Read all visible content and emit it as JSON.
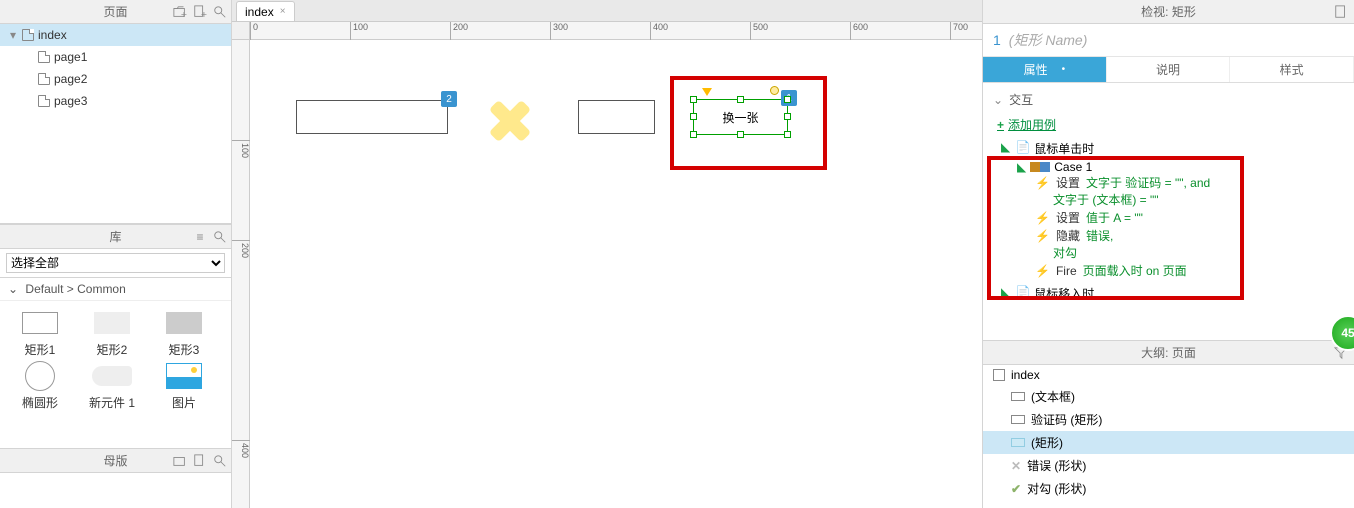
{
  "left": {
    "pages_title": "页面",
    "library_title": "库",
    "masters_title": "母版",
    "tree": {
      "root": "index",
      "children": [
        "page1",
        "page2",
        "page3"
      ]
    },
    "library_select": "选择全部",
    "library_group": "Default > Common",
    "widgets": [
      {
        "id": "rect1",
        "label": "矩形1"
      },
      {
        "id": "rect2",
        "label": "矩形2"
      },
      {
        "id": "rect3",
        "label": "矩形3"
      },
      {
        "id": "ellipse",
        "label": "椭圆形"
      },
      {
        "id": "pill",
        "label": "新元件 1"
      },
      {
        "id": "image",
        "label": "图片"
      }
    ]
  },
  "canvas": {
    "tab_name": "index",
    "ruler_h": [
      "0",
      "100",
      "200",
      "300",
      "400",
      "500",
      "600",
      "700"
    ],
    "ruler_v": [
      "100",
      "200",
      "400"
    ],
    "obj2_badge": "2",
    "obj1_badge": "1",
    "selected_text": "换一张"
  },
  "right": {
    "inspector_title": "检视: 矩形",
    "shape_index": "1",
    "shape_name_placeholder": "(矩形 Name)",
    "tabs": {
      "properties": "属性",
      "notes": "说明",
      "style": "样式"
    },
    "interactions": {
      "section": "交互",
      "add_case": "添加用例",
      "event_click": "鼠标单击时",
      "event_move": "鼠标移入时",
      "case_label": "Case 1",
      "actions": {
        "set_text_kw": "设置",
        "set_text_tgt": "文字于 验证码 = \"\", and",
        "set_text_cont": "文字于 (文本框) = \"\"",
        "set_val_kw": "设置",
        "set_val_tgt": "值于 A = \"\"",
        "hide_kw": "隐藏",
        "hide_tgt": "错误,",
        "hide_cont": "对勾",
        "fire_kw": "Fire",
        "fire_tgt": "页面载入时 on 页面"
      }
    },
    "outline": {
      "title": "大纲: 页面",
      "root": "index",
      "items": [
        {
          "label": "(文本框)",
          "icon": "rect"
        },
        {
          "label": "验证码 (矩形)",
          "icon": "rect"
        },
        {
          "label": "(矩形)",
          "icon": "rect-fill",
          "selected": true
        },
        {
          "label": "错误 (形状)",
          "icon": "x"
        },
        {
          "label": "对勾 (形状)",
          "icon": "check"
        }
      ]
    }
  },
  "badge_45": "45"
}
